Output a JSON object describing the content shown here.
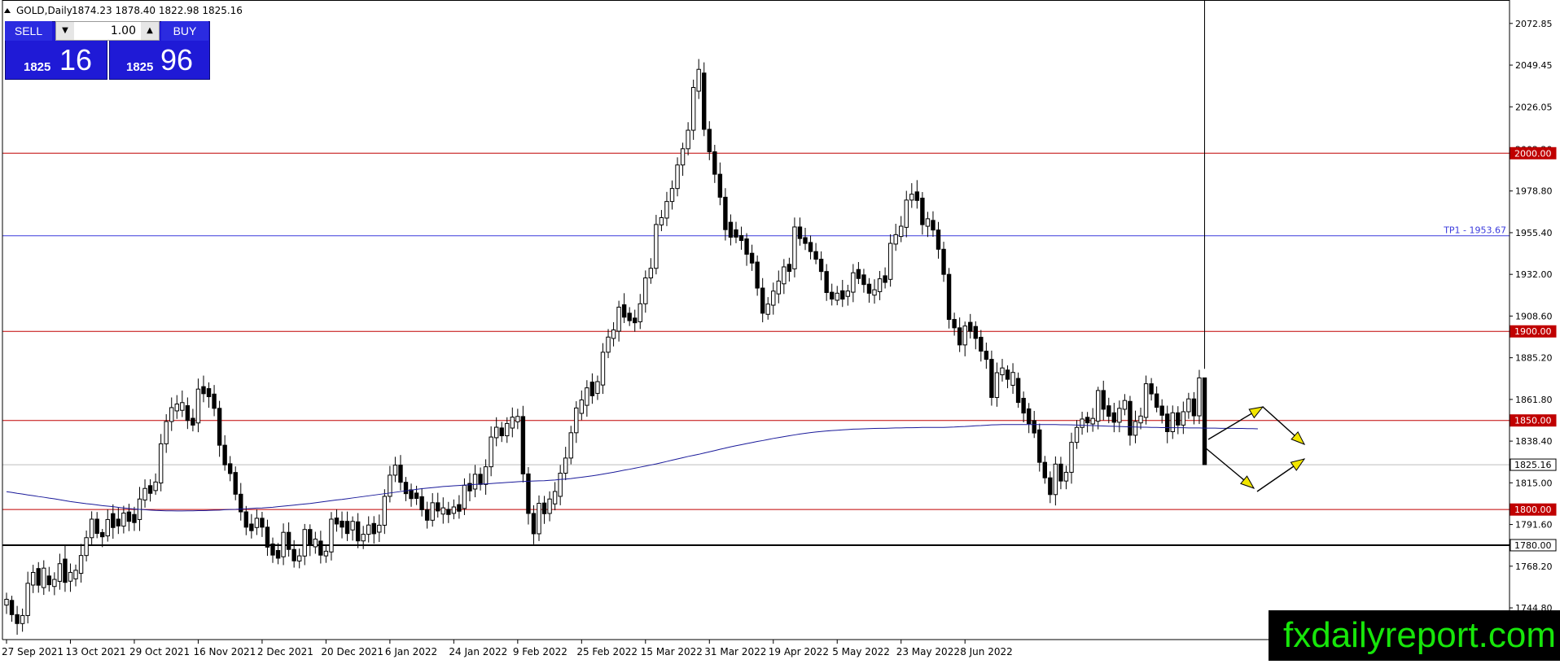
{
  "header": {
    "symbol": "GOLD,Daily",
    "ohlc": "1874.23 1878.40 1822.98 1825.16"
  },
  "trade_panel": {
    "sell_label": "SELL",
    "buy_label": "BUY",
    "lot": "1.00",
    "sell_price_small": "1825",
    "sell_price_big": "16",
    "buy_price_small": "1825",
    "buy_price_big": "96"
  },
  "brand": "fxdailyreport.com",
  "chart_data": {
    "type": "candlestick",
    "ylim": [
      1727.0,
      2086.0
    ],
    "y_ticks": [
      "2072.85",
      "2049.45",
      "2026.05",
      "2002.20",
      "1978.80",
      "1955.40",
      "1932.00",
      "1908.60",
      "1885.20",
      "1861.80",
      "1838.40",
      "1815.00",
      "1791.60",
      "1768.20",
      "1744.80"
    ],
    "x_ticks": [
      {
        "label": "27 Sep 2021",
        "index": 0
      },
      {
        "label": "13 Oct 2021",
        "index": 12
      },
      {
        "label": "29 Oct 2021",
        "index": 24
      },
      {
        "label": "16 Nov 2021",
        "index": 36
      },
      {
        "label": "2 Dec 2021",
        "index": 48
      },
      {
        "label": "20 Dec 2021",
        "index": 60
      },
      {
        "label": "6 Jan 2022",
        "index": 72
      },
      {
        "label": "24 Jan 2022",
        "index": 84
      },
      {
        "label": "9 Feb 2022",
        "index": 96
      },
      {
        "label": "25 Feb 2022",
        "index": 108
      },
      {
        "label": "15 Mar 2022",
        "index": 120
      },
      {
        "label": "31 Mar 2022",
        "index": 132
      },
      {
        "label": "19 Apr 2022",
        "index": 144
      },
      {
        "label": "5 May 2022",
        "index": 156
      },
      {
        "label": "23 May 2022",
        "index": 168
      },
      {
        "label": "8 Jun 2022",
        "index": 180
      }
    ],
    "closes": [
      1749.0,
      1741.0,
      1736.0,
      1740.5,
      1758.6,
      1763.7,
      1760.7,
      1762.6,
      1757.9,
      1759.7,
      1769.6,
      1761.7,
      1762.8,
      1764.2,
      1774.2,
      1784.2,
      1794.6,
      1786.6,
      1785.2,
      1794.4,
      1793.2,
      1792.2,
      1796.5,
      1795.5,
      1794.4,
      1805.9,
      1811.3,
      1811.2,
      1814.9,
      1836.9,
      1849.4,
      1857.2,
      1857.4,
      1858.3,
      1850.0,
      1848.6,
      1867.6,
      1866.4,
      1864.8,
      1856.8,
      1836.1,
      1825.1,
      1820.8,
      1808.6,
      1798.7,
      1790.1,
      1789.9,
      1795.1,
      1790.1,
      1778.9,
      1776.2,
      1773.5,
      1787.2,
      1777.6,
      1771.2,
      1773.9,
      1788.8,
      1780.2,
      1782.3,
      1774.4,
      1776.2,
      1794.6,
      1792.5,
      1791.1,
      1788.8,
      1793.1,
      1782.4,
      1786.1,
      1791.3,
      1787.3,
      1791.2,
      1807.4,
      1819.3,
      1824.9,
      1815.3,
      1808.9,
      1808.3,
      1807.2,
      1799.9,
      1794.0,
      1803.8,
      1799.2,
      1799.2,
      1798.1,
      1801.2,
      1800.6,
      1813.6,
      1811.5,
      1819.8,
      1814.1,
      1824.0,
      1840.7,
      1845.8,
      1841.4,
      1848.3,
      1849.3,
      1852.2,
      1820.0,
      1797.8,
      1786.4,
      1803.5,
      1797.8,
      1805.9,
      1807.4,
      1820.4,
      1828.9,
      1843.1,
      1857.0,
      1858.5,
      1868.3,
      1867.1,
      1869.9,
      1888.3,
      1896.8,
      1900.1,
      1913.6,
      1909.3,
      1906.9,
      1905.4,
      1915.5,
      1930.0,
      1935.4,
      1960.0,
      1963.6,
      1972.9,
      1980.2,
      1993.4,
      2002.5,
      2012.9,
      2036.9,
      2045.0,
      2013.4,
      2000.8,
      1988.2,
      1975.3,
      1957.1,
      1957.0,
      1952.9,
      1951.9,
      1943.3,
      1938.9,
      1924.3,
      1910.2,
      1914.7,
      1922.6,
      1926.7,
      1936.2,
      1935.1,
      1958.6,
      1952.1,
      1949.9,
      1944.8,
      1940.5,
      1933.6,
      1921.8,
      1918.3,
      1920.6,
      1920.3,
      1922.0,
      1932.9,
      1931.5,
      1926.5,
      1921.4,
      1922.3,
      1929.5,
      1929.2,
      1949.4,
      1953.9,
      1958.4,
      1973.7,
      1977.0,
      1974.8,
      1959.9,
      1962.3,
      1956.9,
      1946.1,
      1932.0,
      1906.7,
      1902.0,
      1892.4,
      1903.0,
      1902.1,
      1896.7,
      1888.9,
      1884.3,
      1862.9,
      1876.8,
      1878.3,
      1873.1,
      1873.6,
      1860.1,
      1856.5,
      1848.2,
      1844.7,
      1826.5,
      1817.8,
      1808.4,
      1825.5,
      1816.0,
      1820.9,
      1837.7,
      1846.1,
      1850.8,
      1849.6,
      1849.6,
      1866.8,
      1856.3,
      1854.3,
      1849.0,
      1856.8,
      1860.7,
      1841.7,
      1849.4,
      1851.7,
      1870.6,
      1864.9,
      1857.4,
      1853.6,
      1843.7,
      1854.3,
      1847.4,
      1854.9,
      1862.1,
      1852.6,
      1873.9,
      1825.2
    ],
    "body_half_height": [
      2.7,
      3.7,
      2.1,
      2.1,
      2.6,
      5.9,
      7.8,
      9.1,
      4.1,
      3.3,
      8.2,
      10.9,
      4.1,
      4.0,
      5.9,
      1.6,
      3.5,
      5.2,
      2.0,
      2.4,
      6.5,
      3.2,
      6.1,
      4.4,
      3.8,
      3.3,
      5.4,
      3.6,
      4.0,
      2.6,
      5.5,
      2.4,
      3.2,
      3.6,
      5.6,
      3.2,
      2.3,
      3.3,
      3.8,
      4.0,
      3.4,
      3.3,
      4.6,
      4.7,
      4.5,
      3.3,
      3.1,
      3.5,
      2.6,
      4.3,
      5.2,
      3.6,
      4.1,
      2.0,
      2.7,
      2.4,
      3.5,
      3.6,
      3.6,
      4.2,
      2.2,
      2.6,
      2.8,
      2.8,
      5.7,
      4.0,
      5.0,
      3.1,
      2.7,
      4.8,
      2.8,
      2.5,
      2.5,
      2.8,
      3.4,
      3.2,
      4.1,
      2.5,
      3.3,
      4.4,
      3.9,
      2.0,
      2.9,
      2.4,
      3.0,
      3.1,
      2.3,
      3.5,
      5.1,
      4.7,
      3.5,
      3.0,
      4.9,
      2.8,
      2.3,
      5.1,
      2.5,
      3.5,
      4.5,
      5.1,
      3.3,
      5.0,
      4.7,
      5.8,
      2.8,
      2.1,
      4.8,
      4.4,
      6.3,
      4.9,
      6.4,
      5.5,
      2.2,
      3.2,
      4.0,
      2.8,
      5.8,
      3.5,
      2.2,
      3.0,
      5.1,
      3.4,
      5.0,
      3.4,
      5.8,
      3.0,
      6.2,
      2.9,
      6.3,
      7.3,
      10.2,
      9.8,
      8.1,
      6.7,
      5.4,
      8.0,
      7.0,
      3.2,
      2.3,
      3.3,
      4.6,
      3.5,
      3.8,
      4.8,
      3.8,
      6.0,
      5.3,
      3.3,
      2.4,
      4.6,
      2.7,
      3.9,
      3.5,
      3.5,
      4.4,
      3.2,
      3.3,
      3.9,
      2.5,
      3.8,
      4.2,
      4.5,
      3.5,
      2.5,
      3.2,
      3.1,
      4.7,
      4.4,
      4.8,
      2.5,
      2.5,
      4.0,
      5.7,
      3.5,
      3.2,
      2.9,
      6.2,
      3.8,
      3.3,
      2.6,
      5.5,
      4.2,
      5.6,
      2.4,
      3.8,
      4.3,
      4.5,
      3.2,
      3.3,
      6.0,
      2.8,
      6.9,
      3.2,
      5.8,
      3.5,
      4.1,
      4.8,
      3.7,
      3.9,
      3.1,
      2.6,
      4.2,
      3.5,
      2.6,
      2.6,
      2.4,
      5.6,
      4.9,
      3.5,
      3.0,
      4.1,
      4.5,
      6.0,
      3.2,
      4.2,
      4.7,
      3.5,
      4.3,
      4.8,
      4.7,
      5.7,
      3.6,
      3.7,
      3.8,
      5.7,
      3.0
    ],
    "hi_wick": [
      3.7,
      2.6,
      4.9,
      3.9,
      6.5,
      4.3,
      3.6,
      4.4,
      5.1,
      4.0,
      5.6,
      7.5,
      5.0,
      3.2,
      6.5,
      4.0,
      4.4,
      4.0,
      2.0,
      5.7,
      5.2,
      6.6,
      4.1,
      4.6,
      4.3,
      6.8,
      5.1,
      3.6,
      4.8,
      5.5,
      4.1,
      5.7,
      5.0,
      6.8,
      4.6,
      5.3,
      5.9,
      6.2,
      3.5,
      5.1,
      4.2,
      5.6,
      4.3,
      3.4,
      6.3,
      3.3,
      5.6,
      5.0,
      3.6,
      4.2,
      3.6,
      4.2,
      5.0,
      5.6,
      5.2,
      4.1,
      3.1,
      2.9,
      4.1,
      5.8,
      3.6,
      4.0,
      4.9,
      5.4,
      5.5,
      2.8,
      4.9,
      4.7,
      4.9,
      4.1,
      6.0,
      4.0,
      5.2,
      4.7,
      5.7,
      3.0,
      3.5,
      4.1,
      4.8,
      4.5,
      5.4,
      5.6,
      5.9,
      4.2,
      4.2,
      5.3,
      3.9,
      5.7,
      5.2,
      3.8,
      4.2,
      6.0,
      5.6,
      3.4,
      3.5,
      5.4,
      4.3,
      6.0,
      3.8,
      4.6,
      4.4,
      4.0,
      4.3,
      5.3,
      4.6,
      6.3,
      3.9,
      3.8,
      5.3,
      4.3,
      4.9,
      3.4,
      5.1,
      4.5,
      4.3,
      3.6,
      6.5,
      3.4,
      4.7,
      5.5,
      4.2,
      5.7,
      5.4,
      4.3,
      5.4,
      4.5,
      4.3,
      3.4,
      4.5,
      4.4,
      5.8,
      6.0,
      4.6,
      3.9,
      6.6,
      5.1,
      4.4,
      4.5,
      5.0,
      3.2,
      4.8,
      3.7,
      5.6,
      3.9,
      4.8,
      5.9,
      4.4,
      3.7,
      5.3,
      5.3,
      5.5,
      3.9,
      4.8,
      4.4,
      4.2,
      4.8,
      4.1,
      6.1,
      3.5,
      4.9,
      4.2,
      3.4,
      3.4,
      5.9,
      4.4,
      4.7,
      5.1,
      6.1,
      5.7,
      5.2,
      6.2,
      6.6,
      3.4,
      3.9,
      5.1,
      4.5,
      4.2,
      3.6,
      3.8,
      5.8,
      2.5,
      4.7,
      2.9,
      4.1,
      4.8,
      4.9,
      5.7,
      5.1,
      2.6,
      5.2,
      3.3,
      3.8,
      3.3,
      5.4,
      3.5,
      3.6,
      3.6,
      4.3,
      4.1,
      3.7,
      5.4,
      4.1,
      4.1,
      3.0,
      5.8,
      2.1,
      5.5,
      4.5,
      5.6,
      4.4,
      3.6,
      3.1,
      6.1,
      4.7,
      4.6,
      3.2,
      4.2,
      3.8,
      4.7,
      4.1,
      3.7,
      5.7,
      3.4,
      3.8,
      4.5,
      5.1,
      4.3,
      4.2
    ],
    "lo_wick": [
      5.0,
      4.0,
      6.3,
      4.6,
      4.4,
      4.5,
      4.2,
      4.1,
      3.8,
      4.9,
      4.7,
      5.3,
      6.0,
      4.2,
      5.2,
      3.3,
      4.2,
      2.7,
      5.8,
      3.2,
      6.3,
      4.5,
      4.1,
      5.5,
      4.7,
      6.4,
      4.3,
      4.6,
      2.4,
      4.7,
      5.1,
      5.3,
      4.5,
      3.8,
      4.8,
      3.5,
      5.2,
      4.8,
      6.2,
      4.4,
      6.5,
      3.3,
      4.3,
      3.4,
      4.9,
      4.5,
      4.4,
      4.2,
      5.5,
      4.9,
      4.4,
      3.4,
      4.7,
      4.0,
      3.8,
      4.1,
      5.1,
      6.3,
      3.9,
      4.7,
      3.9,
      4.8,
      4.3,
      6.3,
      4.2,
      6.0,
      4.1,
      4.6,
      4.6,
      5.6,
      5.5,
      4.9,
      3.4,
      3.9,
      4.6,
      4.2,
      4.6,
      3.7,
      3.8,
      4.7,
      3.6,
      3.7,
      5.4,
      4.8,
      3.3,
      4.2,
      3.7,
      5.8,
      4.6,
      3.4,
      5.8,
      5.3,
      4.8,
      3.5,
      4.0,
      5.2,
      4.1,
      4.8,
      6.2,
      5.9,
      4.1,
      5.7,
      4.4,
      3.6,
      5.0,
      3.9,
      3.5,
      5.7,
      3.8,
      6.4,
      4.5,
      3.7,
      5.0,
      3.3,
      4.5,
      5.8,
      3.3,
      3.0,
      5.0,
      4.1,
      5.0,
      3.3,
      3.4,
      3.5,
      4.5,
      4.5,
      4.4,
      6.1,
      3.7,
      5.4,
      4.4,
      3.8,
      4.7,
      4.9,
      4.5,
      6.1,
      4.6,
      3.4,
      5.2,
      6.5,
      4.4,
      4.3,
      5.1,
      3.0,
      5.3,
      5.3,
      5.7,
      5.7,
      4.8,
      4.0,
      3.7,
      4.4,
      2.8,
      4.9,
      4.7,
      3.6,
      2.8,
      4.4,
      5.2,
      5.6,
      3.1,
      4.6,
      5.3,
      4.8,
      4.8,
      3.4,
      4.1,
      3.8,
      3.2,
      5.6,
      4.4,
      4.6,
      5.6,
      6.0,
      3.8,
      5.3,
      4.2,
      5.1,
      4.4,
      4.0,
      6.4,
      4.0,
      6.1,
      5.8,
      5.3,
      4.6,
      5.2,
      3.8,
      5.0,
      4.8,
      3.0,
      5.2,
      5.3,
      2.8,
      5.2,
      3.3,
      4.8,
      6.1,
      4.6,
      4.6,
      6.4,
      3.7,
      4.1,
      5.4,
      4.4,
      4.6,
      6.2,
      3.9,
      5.6,
      5.6,
      3.4,
      5.8,
      4.5,
      3.6,
      4.0,
      3.7,
      2.8,
      4.6,
      6.5,
      4.1,
      5.1,
      5.0,
      4.0,
      4.8,
      4.6
    ],
    "ma": [
      1810.0,
      1809.6,
      1809.1,
      1808.7,
      1808.2,
      1807.8,
      1807.3,
      1806.9,
      1806.4,
      1806.0,
      1805.5,
      1805.0,
      1804.5,
      1804.1,
      1803.7,
      1803.3,
      1803.0,
      1802.6,
      1802.2,
      1801.9,
      1801.6,
      1801.2,
      1800.9,
      1800.6,
      1800.3,
      1800.1,
      1799.9,
      1799.7,
      1799.5,
      1799.4,
      1799.3,
      1799.3,
      1799.2,
      1799.2,
      1799.3,
      1799.3,
      1799.4,
      1799.4,
      1799.5,
      1799.6,
      1799.7,
      1799.9,
      1800.0,
      1800.1,
      1800.3,
      1800.4,
      1800.6,
      1800.8,
      1800.9,
      1801.1,
      1801.3,
      1801.6,
      1801.9,
      1802.2,
      1802.5,
      1802.8,
      1803.1,
      1803.4,
      1803.8,
      1804.2,
      1804.6,
      1805.0,
      1805.4,
      1805.7,
      1806.1,
      1806.5,
      1806.9,
      1807.3,
      1807.7,
      1808.1,
      1808.5,
      1808.9,
      1809.3,
      1809.7,
      1810.1,
      1810.5,
      1810.9,
      1811.3,
      1811.7,
      1812.0,
      1812.3,
      1812.6,
      1812.9,
      1813.1,
      1813.3,
      1813.5,
      1813.7,
      1813.9,
      1814.1,
      1814.3,
      1814.4,
      1814.6,
      1814.8,
      1815.0,
      1815.2,
      1815.4,
      1815.6,
      1815.8,
      1815.9,
      1816.0,
      1816.1,
      1816.2,
      1816.4,
      1816.6,
      1816.9,
      1817.1,
      1817.4,
      1817.8,
      1818.1,
      1818.5,
      1818.9,
      1819.4,
      1819.9,
      1820.4,
      1820.9,
      1821.5,
      1822.1,
      1822.6,
      1823.2,
      1823.8,
      1824.4,
      1825.0,
      1825.6,
      1826.3,
      1827.0,
      1827.7,
      1828.4,
      1829.1,
      1829.8,
      1830.4,
      1831.0,
      1831.7,
      1832.4,
      1833.1,
      1833.8,
      1834.5,
      1835.2,
      1835.8,
      1836.4,
      1837.0,
      1837.6,
      1838.2,
      1838.7,
      1839.3,
      1839.9,
      1840.4,
      1840.9,
      1841.4,
      1841.9,
      1842.4,
      1842.8,
      1843.2,
      1843.5,
      1843.8,
      1844.1,
      1844.3,
      1844.5,
      1844.7,
      1844.9,
      1845.1,
      1845.2,
      1845.3,
      1845.4,
      1845.5,
      1845.6,
      1845.6,
      1845.7,
      1845.8,
      1845.8,
      1845.9,
      1845.9,
      1846.0,
      1846.1,
      1846.1,
      1846.1,
      1846.1,
      1846.1,
      1846.2,
      1846.3,
      1846.5,
      1846.6,
      1846.8,
      1847.0,
      1847.1,
      1847.3,
      1847.5,
      1847.6,
      1847.7,
      1847.7,
      1847.7,
      1847.7,
      1847.7,
      1847.7,
      1847.7,
      1847.7,
      1847.7,
      1847.7,
      1847.7,
      1847.6,
      1847.6,
      1847.5,
      1847.4,
      1847.3,
      1847.2,
      1847.1,
      1847.0,
      1846.9,
      1846.8,
      1846.7,
      1846.6,
      1846.5,
      1846.4,
      1846.3,
      1846.2,
      1846.2,
      1846.1,
      1846.1,
      1846.0,
      1846.0,
      1845.9,
      1845.9,
      1845.9,
      1845.8,
      1845.8,
      1845.8,
      1845.7,
      1845.7,
      1845.7,
      1845.6,
      1845.6,
      1845.6,
      1845.5,
      1845.5,
      1845.4,
      1845.4,
      1845.3
    ],
    "horizontal_levels": [
      {
        "value": 2000.0,
        "label": "2000.00",
        "color": "#c00000"
      },
      {
        "value": 1953.67,
        "label": "TP1 - 1953.67",
        "color": "#3a3adc"
      },
      {
        "value": 1900.0,
        "label": "1900.00",
        "color": "#c00000"
      },
      {
        "value": 1850.0,
        "label": "1850.00",
        "color": "#c00000"
      },
      {
        "value": 1800.0,
        "label": "1800.00",
        "color": "#c00000"
      },
      {
        "value": 1780.0,
        "label": "1780.00",
        "color": "#000000"
      },
      {
        "value": 1825.16,
        "label": "1825.16",
        "color": "#000000"
      }
    ],
    "colors": {
      "bull": "#ffffff",
      "bear": "#000000",
      "ma": "#1a1a9a",
      "arrow_head": "#f2e600"
    }
  }
}
